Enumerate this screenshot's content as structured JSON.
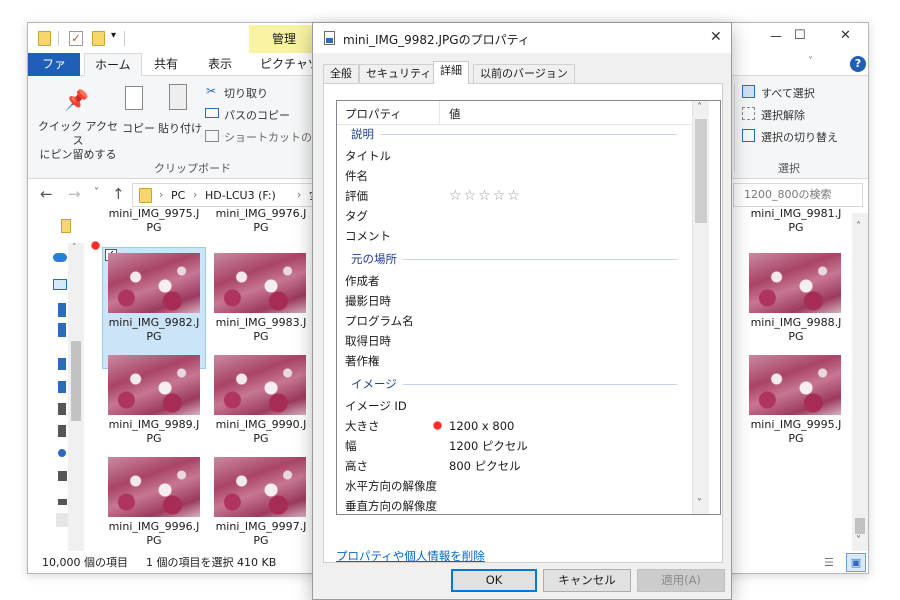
{
  "explorer": {
    "ribbon_tabs": [
      "ファイル",
      "ホーム",
      "共有",
      "表示",
      "ピクチャツー"
    ],
    "contextual_tab": "管理",
    "window_controls": {
      "minimize": "—",
      "maximize": "☐",
      "close": "✕"
    },
    "help": "?",
    "clipboard": {
      "quick_access": "クイック アクセス\nにピン留めする",
      "copy": "コピー",
      "paste": "貼り付け",
      "cut": "切り取り",
      "copy_path": "パスのコピー",
      "paste_shortcut": "ショートカットの貼り付",
      "group_label": "クリップボード"
    },
    "select": {
      "select_all": "すべて選択",
      "select_none": "選択解除",
      "invert": "選択の切り替え",
      "group_label": "選択"
    },
    "address": {
      "parts": [
        "PC",
        "HD-LCU3 (F:)",
        "写"
      ],
      "sep": "›",
      "search_placeholder": "1200_800の検索"
    },
    "files": [
      {
        "label": "mini_IMG_9975.J\nPG"
      },
      {
        "label": "mini_IMG_9976.J\nPG"
      },
      {
        "label": "mini_IMG_9981.J\nPG"
      },
      {
        "label": "mini_IMG_9982.J\nPG"
      },
      {
        "label": "mini_IMG_9983.J\nPG"
      },
      {
        "label": "mini_IMG_9988.J\nPG"
      },
      {
        "label": "mini_IMG_9989.J\nPG"
      },
      {
        "label": "mini_IMG_9990.J\nPG"
      },
      {
        "label": "mini_IMG_9995.J\nPG"
      },
      {
        "label": "mini_IMG_9996.J\nPG"
      },
      {
        "label": "mini_IMG_9997.J\nPG"
      }
    ],
    "status": {
      "count": "10,000 個の項目",
      "selected": "1 個の項目を選択  410 KB"
    },
    "view_toggle": [
      "☰",
      "▣"
    ]
  },
  "dialog": {
    "title": "mini_IMG_9982.JPGのプロパティ",
    "close": "✕",
    "tabs": [
      "全般",
      "セキュリティ",
      "詳細",
      "以前のバージョン"
    ],
    "active_tab": "詳細",
    "columns": {
      "name": "プロパティ",
      "value": "値"
    },
    "sections": {
      "description": "説明",
      "origin": "元の場所",
      "image": "イメージ"
    },
    "description_rows": [
      "タイトル",
      "件名",
      "評価",
      "タグ",
      "コメント"
    ],
    "rating_stars": "☆☆☆☆☆",
    "rating_value": 0,
    "origin_rows": [
      "作成者",
      "撮影日時",
      "プログラム名",
      "取得日時",
      "著作権"
    ],
    "image_rows": [
      {
        "name": "イメージ ID",
        "value": ""
      },
      {
        "name": "大きさ",
        "value": "1200 x 800"
      },
      {
        "name": "幅",
        "value": "1200 ピクセル"
      },
      {
        "name": "高さ",
        "value": "800 ピクセル"
      },
      {
        "name": "水平方向の解像度",
        "value": ""
      },
      {
        "name": "垂直方向の解像度",
        "value": ""
      }
    ],
    "remove_link": "プロパティや個人情報を削除",
    "buttons": {
      "ok": "OK",
      "cancel": "キャンセル",
      "apply": "適用(A)"
    },
    "scroll_arrows": {
      "up": "˄",
      "down": "˅"
    }
  },
  "colors": {
    "file_tab": "#1f5fb8",
    "contextual_tab": "#f8f3a2",
    "section_heading": "#1e3f8c",
    "link": "#0066cc",
    "thumb_pink": "#a94466"
  }
}
